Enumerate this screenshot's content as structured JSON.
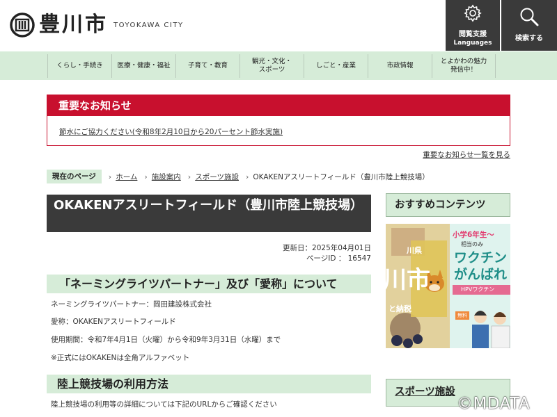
{
  "header": {
    "site_name": "豊川市",
    "site_name_en": "TOYOKAWA CITY",
    "languages_btn": {
      "line1": "閲覧支援",
      "line2": "Languages",
      "icon": "gear-icon"
    },
    "search_btn": {
      "label": "検索する",
      "icon": "search-icon"
    }
  },
  "nav": {
    "items": [
      {
        "label": "くらし・手続き"
      },
      {
        "label": "医療・健康・福祉"
      },
      {
        "label": "子育て・教育"
      },
      {
        "label1": "観光・文化・",
        "label2": "スポーツ"
      },
      {
        "label": "しごと・産業"
      },
      {
        "label": "市政情報"
      },
      {
        "label1": "とよかわの魅力",
        "label2": "発信中！"
      }
    ]
  },
  "notice": {
    "title": "重要なお知らせ",
    "item": "節水にご協力ください(令和8年2月10日から20パーセント節水実施)",
    "all_link": "重要なお知らせ一覧を見る"
  },
  "breadcrumb": {
    "here": "現在のページ",
    "items": [
      "ホーム",
      "施設案内",
      "スポーツ施設",
      "OKAKENアスリートフィールド（豊川市陸上競技場）"
    ]
  },
  "main": {
    "title": "OKAKENアスリートフィールド（豊川市陸上競技場）",
    "updated": "更新日：2025年04月01日",
    "page_id": "ページID ： 16547",
    "section1": {
      "heading": "「ネーミングライツパートナー」及び「愛称」について",
      "lines": [
        "ネーミングライツパートナー：岡田建設株式会社",
        "愛称：OKAKENアスリートフィールド",
        "使用期間：令和7年4月1日（火曜）から令和9年3月31日（水曜）まで",
        "※正式にはOKAKENは全角アルファベット"
      ]
    },
    "section2": {
      "heading": "陸上競技場の利用方法",
      "line": "陸上競技場の利用等の詳細については下記のURLからご確認ください"
    }
  },
  "sidebar": {
    "recommended": "おすすめコンテンツ",
    "banner": {
      "left_text1": "川県",
      "left_text2": "川市",
      "left_text3": "と納税",
      "right_bubble": "小学6年生〜",
      "right_sub": "相当のみ",
      "right_big1": "ワクチン",
      "right_big2": "がんばれ",
      "right_tag": "HPVワクチン",
      "right_free": "無料"
    },
    "sports": "スポーツ施設"
  },
  "copyright": "©MDATA",
  "colors": {
    "accent_green": "#d6ecd8",
    "notice_red": "#c8102e",
    "dark": "#3a3a3a"
  }
}
